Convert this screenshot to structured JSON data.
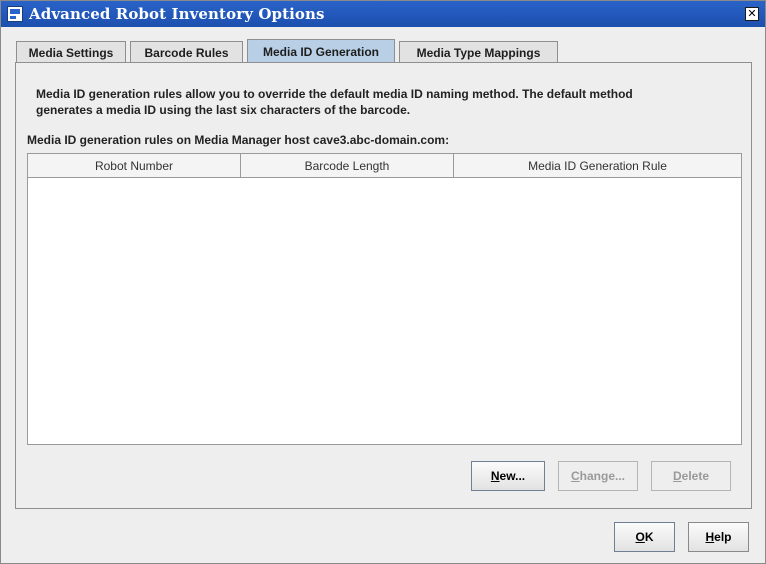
{
  "window": {
    "title": "Advanced Robot Inventory Options",
    "close_label": "✕"
  },
  "tabs": [
    {
      "label": "Media Settings",
      "active": false
    },
    {
      "label": "Barcode Rules",
      "active": false
    },
    {
      "label": "Media ID Generation",
      "active": true
    },
    {
      "label": "Media Type Mappings",
      "active": false
    }
  ],
  "panel": {
    "description_line1": "Media ID generation rules allow you to override the default media ID naming method.  The default method",
    "description_line2": "generates a media ID using the last six characters of the barcode.",
    "host_label": "Media ID generation rules on Media Manager host cave3.abc-domain.com:",
    "table": {
      "columns": [
        "Robot Number",
        "Barcode Length",
        "Media ID Generation Rule"
      ],
      "rows": []
    },
    "buttons": {
      "new": {
        "label": "New...",
        "mnemonic": "N",
        "rest": "ew...",
        "enabled": true
      },
      "change": {
        "label": "Change...",
        "mnemonic": "C",
        "rest": "hange...",
        "enabled": false
      },
      "delete": {
        "label": "Delete",
        "mnemonic": "D",
        "rest": "elete",
        "enabled": false
      }
    }
  },
  "footer": {
    "ok": {
      "label": "OK",
      "mnemonic": "O",
      "rest": "K"
    },
    "help": {
      "label": "Help",
      "mnemonic": "H",
      "rest": "elp"
    }
  }
}
